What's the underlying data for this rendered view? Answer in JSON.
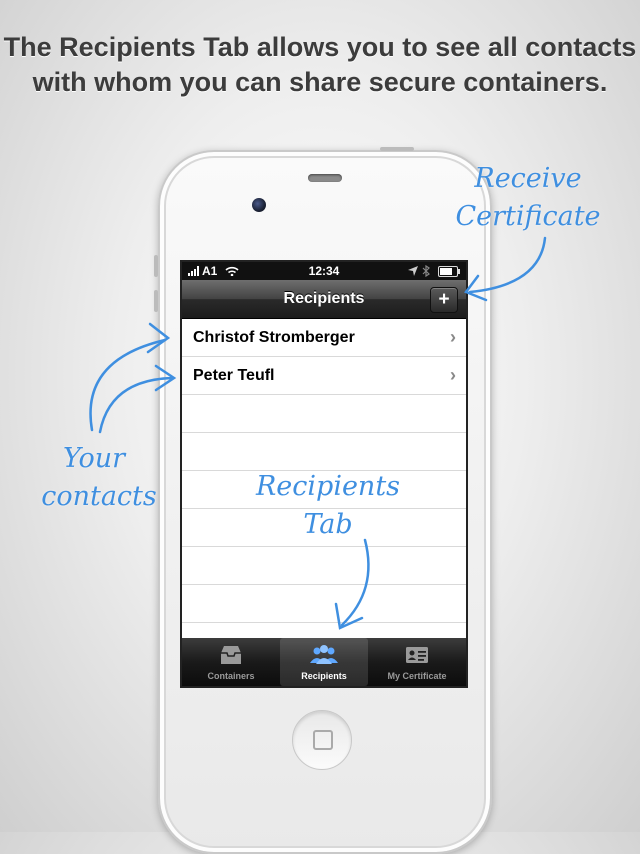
{
  "headline": "The Recipients Tab allows you to see all contacts with whom you can share secure containers.",
  "status_bar": {
    "carrier": "A1",
    "time": "12:34"
  },
  "nav": {
    "title": "Recipients",
    "add_label": "+"
  },
  "recipients": [
    {
      "name": "Christof Stromberger",
      "chevron": "›"
    },
    {
      "name": "Peter Teufl",
      "chevron": "›"
    }
  ],
  "empty_rows": 6,
  "tabs": [
    {
      "label": "Containers",
      "icon": "tray-icon",
      "active": false
    },
    {
      "label": "Recipients",
      "icon": "people-icon",
      "active": true
    },
    {
      "label": "My Certificate",
      "icon": "id-card-icon",
      "active": false
    }
  ],
  "annotations": {
    "receive": "Receive",
    "certificate": "Certificate",
    "your": "Your",
    "contacts": "contacts",
    "recipients_tab_1": "Recipients",
    "recipients_tab_2": "Tab"
  },
  "colors": {
    "annotation": "#3f8fe0",
    "headline": "#3c3c3c"
  }
}
